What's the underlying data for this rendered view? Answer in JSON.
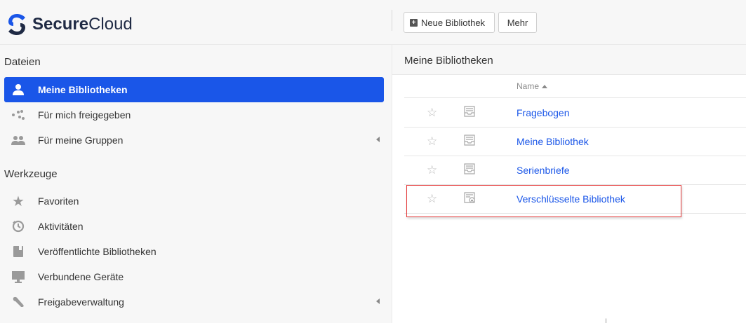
{
  "app": {
    "logo_bold": "Secure",
    "logo_regular": "Cloud",
    "brand_color": "#1a56e8"
  },
  "toolbar": {
    "new_library_label": "Neue Bibliothek",
    "more_label": "Mehr"
  },
  "sidebar": {
    "files_title": "Dateien",
    "files_items": [
      {
        "label": "Meine Bibliotheken",
        "icon": "user-icon",
        "active": true
      },
      {
        "label": "Für mich freigegeben",
        "icon": "share-icon"
      },
      {
        "label": "Für meine Gruppen",
        "icon": "group-icon",
        "expandable": true
      }
    ],
    "tools_title": "Werkzeuge",
    "tools_items": [
      {
        "label": "Favoriten",
        "icon": "star-icon"
      },
      {
        "label": "Aktivitäten",
        "icon": "history-icon"
      },
      {
        "label": "Veröffentlichte Bibliotheken",
        "icon": "book-icon"
      },
      {
        "label": "Verbundene Geräte",
        "icon": "monitor-icon"
      },
      {
        "label": "Freigabeverwaltung",
        "icon": "wrench-icon",
        "expandable": true
      }
    ]
  },
  "main": {
    "title": "Meine Bibliotheken",
    "column_name": "Name",
    "libraries": [
      {
        "name": "Fragebogen",
        "icon": "library-icon",
        "starred": false
      },
      {
        "name": "Meine Bibliothek",
        "icon": "library-icon",
        "starred": false
      },
      {
        "name": "Serienbriefe",
        "icon": "library-icon",
        "starred": false
      },
      {
        "name": "Verschlüsselte Bibliothek",
        "icon": "encrypted-library-icon",
        "starred": false,
        "highlighted": true
      }
    ]
  }
}
